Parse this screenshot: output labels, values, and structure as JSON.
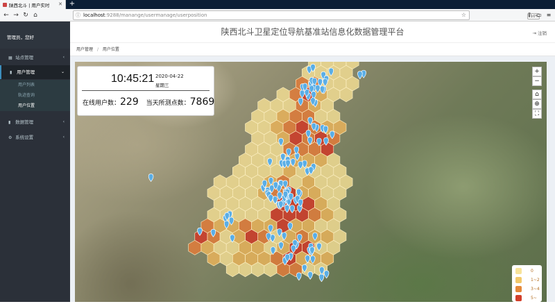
{
  "browser": {
    "tab_title": "陕西北斗 | 用户实时",
    "url_host": "localhost",
    "url_path": ":9288/manange/usermanage/userposition",
    "zoom": "110%"
  },
  "sidebar": {
    "greeting": "管理员，您好",
    "items": [
      {
        "label": "站点管理"
      },
      {
        "label": "用户管理"
      },
      {
        "label": "数据管理"
      },
      {
        "label": "系统设置"
      }
    ],
    "subitems": [
      {
        "label": "用户列表"
      },
      {
        "label": "轨迹查询"
      },
      {
        "label": "用户位置"
      }
    ]
  },
  "header": {
    "title": "陕西北斗卫星定位导航基准站信息化数据管理平台",
    "logout": "注销"
  },
  "breadcrumb": {
    "parent": "用户管理",
    "separator": "/",
    "current": "用户位置"
  },
  "info": {
    "time": "10:45:21",
    "date": "2020-04-22",
    "weekday": "星期三",
    "online_label": "在线用户数：",
    "online_count": "229",
    "points_label": "当天所测点数：",
    "points_count": "7869"
  },
  "map_controls": {
    "zoom_in": "+",
    "zoom_out": "−"
  },
  "legend": {
    "items": [
      {
        "label": "0",
        "color": "#f7e39a"
      },
      {
        "label": "1~2",
        "color": "#f2c96b"
      },
      {
        "label": "3~4",
        "color": "#e5893a"
      },
      {
        "label": "5~",
        "color": "#d23f2a"
      }
    ]
  },
  "colors": {
    "hex_light": "#f1dc93",
    "hex_mid": "#e8b35a",
    "hex_orange": "#e07b3a",
    "hex_red": "#cf3a28",
    "marker": "#5aaee6"
  }
}
